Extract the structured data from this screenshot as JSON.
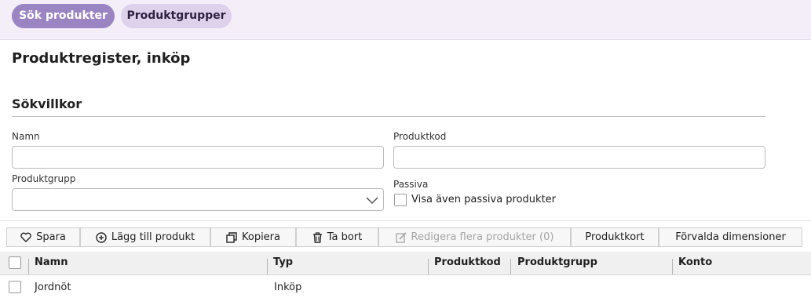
{
  "tabs": [
    {
      "label": "Sök produkter",
      "active": true
    },
    {
      "label": "Produktgrupper",
      "active": false
    }
  ],
  "page_title": "Produktregister, inköp",
  "search": {
    "section_title": "Sökvillkor",
    "name_label": "Namn",
    "name_value": "",
    "code_label": "Produktkod",
    "code_value": "",
    "group_label": "Produktgrupp",
    "group_value": "",
    "passive_label": "Passiva",
    "passive_checkbox_label": "Visa även passiva produkter",
    "passive_checked": false
  },
  "toolbar": {
    "save_label": "Spara",
    "add_label": "Lägg till produkt",
    "copy_label": "Kopiera",
    "delete_label": "Ta bort",
    "edit_many_label": "Redigera flera produkter (0)",
    "product_card_label": "Produktkort",
    "default_dimensions_label": "Förvalda dimensioner"
  },
  "table": {
    "columns": [
      "Namn",
      "Typ",
      "Produktkod",
      "Produktgrupp",
      "Konto"
    ],
    "rows": [
      {
        "name": "Jordnöt",
        "type": "Inköp",
        "code": "",
        "group": "",
        "account": ""
      }
    ]
  },
  "colors": {
    "accent": "#9b84c2",
    "accent_light": "#ddd1ec",
    "header_bg": "#f3eef8"
  },
  "icons": [
    "heart-icon",
    "plus-circle-icon",
    "copy-icon",
    "trash-icon",
    "edit-icon",
    "chevron-down-icon"
  ]
}
